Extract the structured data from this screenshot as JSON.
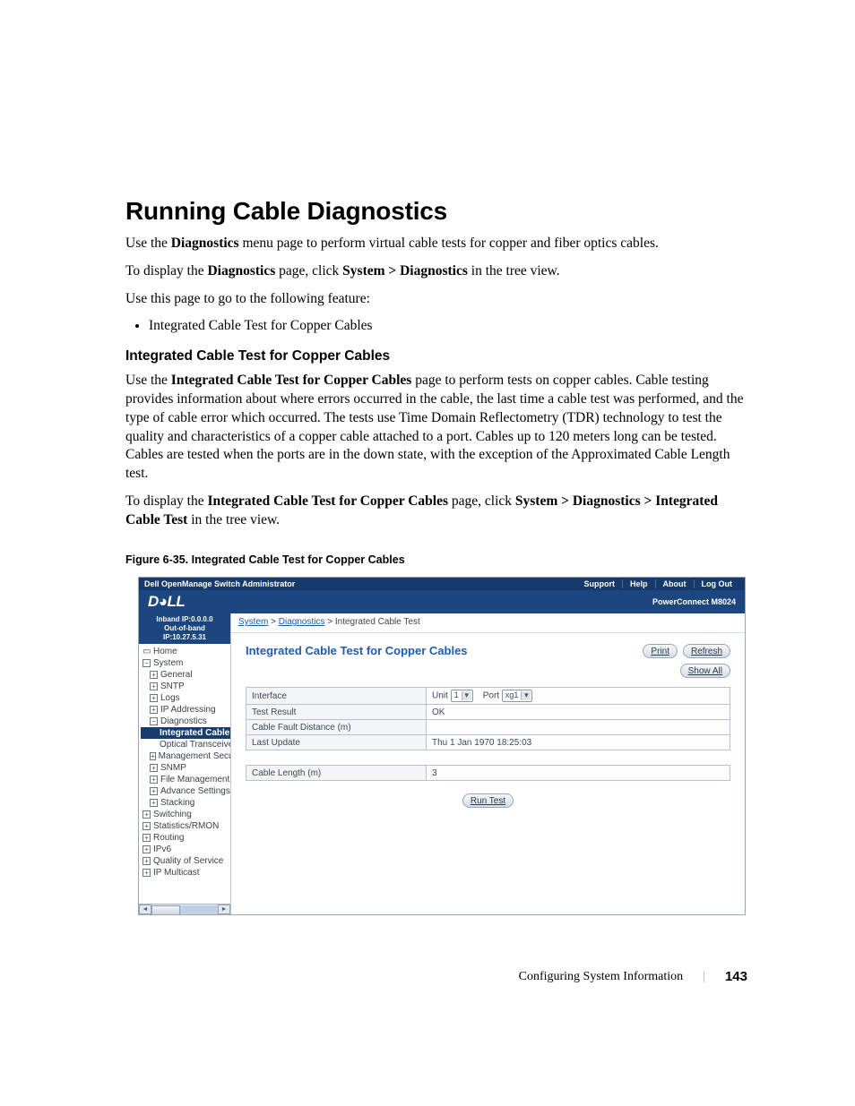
{
  "heading": "Running Cable Diagnostics",
  "p1_a": "Use the ",
  "p1_b": "Diagnostics",
  "p1_c": " menu page to perform virtual cable tests for copper and fiber optics cables.",
  "p2_a": "To display the ",
  "p2_b": "Diagnostics",
  "p2_c": " page, click ",
  "p2_d": "System > Diagnostics",
  "p2_e": " in the tree view.",
  "p3": "Use this page to go to the following feature:",
  "bullet1": "Integrated Cable Test for Copper Cables",
  "sub_h": "Integrated Cable Test for Copper Cables",
  "sp1_a": "Use the ",
  "sp1_b": "Integrated Cable Test for Copper Cables",
  "sp1_c": " page to perform tests on copper cables. Cable testing provides information about where errors occurred in the cable, the last time a cable test was performed, and the type of cable error which occurred. The tests use Time Domain Reflectometry (TDR) technology to test the quality and characteristics of a copper cable attached to a port. Cables up to 120 meters long can be tested. Cables are tested when the ports are in the down state, with the exception of the Approximated Cable Length test.",
  "sp2_a": "To display the ",
  "sp2_b": "Integrated Cable Test for Copper Cables",
  "sp2_c": " page, click ",
  "sp2_d": "System > Diagnostics > Integrated Cable Test",
  "sp2_e": " in the tree view.",
  "fig_caption": "Figure 6-35.    Integrated Cable Test for Copper Cables",
  "shot": {
    "topbar_title": "Dell OpenManage Switch Administrator",
    "toplinks": {
      "support": "Support",
      "help": "Help",
      "about": "About",
      "logout": "Log Out"
    },
    "logo": "D◕LL",
    "product": "PowerConnect M8024",
    "ipbox_l1": "Inband IP:0.0.0.0",
    "ipbox_l2": "Out-of-band IP:10.27.5.31",
    "crumb": {
      "a": "System",
      "b": "Diagnostics",
      "c": "Integrated Cable Test",
      "sep": " > "
    },
    "panel_title": "Integrated Cable Test for Copper Cables",
    "buttons": {
      "print": "Print",
      "refresh": "Refresh",
      "showall": "Show All",
      "runtest": "Run Test"
    },
    "tree": {
      "home": "Home",
      "system": "System",
      "general": "General",
      "sntp": "SNTP",
      "logs": "Logs",
      "ipaddr": "IP Addressing",
      "diag": "Diagnostics",
      "intcable": "Integrated Cable T",
      "optical": "Optical Transceiver",
      "mgmtsec": "Management Security",
      "snmp": "SNMP",
      "filemgmt": "File Management",
      "advset": "Advance Settings",
      "stacking": "Stacking",
      "switching": "Switching",
      "stats": "Statistics/RMON",
      "routing": "Routing",
      "ipv6": "IPv6",
      "qos": "Quality of Service",
      "ipmcast": "IP Multicast"
    },
    "rows": {
      "interface_l": "Interface",
      "interface_unit": "Unit",
      "interface_unit_v": "1",
      "interface_port": "Port",
      "interface_port_v": "xg1",
      "test_result_l": "Test Result",
      "test_result_v": "OK",
      "cfd_l": "Cable Fault Distance (m)",
      "cfd_v": "",
      "last_update_l": "Last Update",
      "last_update_v": "Thu 1 Jan 1970 18:25:03",
      "cablelen_l": "Cable Length (m)",
      "cablelen_v": "3"
    }
  },
  "footer": {
    "section": "Configuring System Information",
    "page": "143"
  },
  "chart_data": {
    "type": "table",
    "title": "Integrated Cable Test for Copper Cables",
    "rows": [
      {
        "field": "Interface",
        "value": "Unit 1 Port xg1"
      },
      {
        "field": "Test Result",
        "value": "OK"
      },
      {
        "field": "Cable Fault Distance (m)",
        "value": ""
      },
      {
        "field": "Last Update",
        "value": "Thu 1 Jan 1970 18:25:03"
      },
      {
        "field": "Cable Length (m)",
        "value": 3
      }
    ]
  }
}
